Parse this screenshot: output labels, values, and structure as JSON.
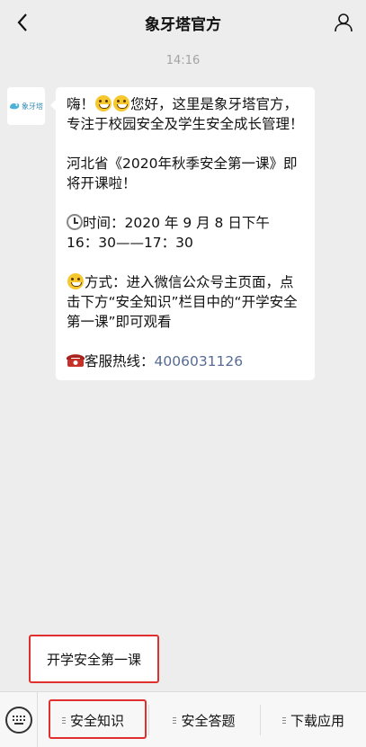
{
  "header": {
    "title": "象牙塔官方"
  },
  "timestamp": "14:16",
  "avatar": {
    "logo_text": "象牙塔"
  },
  "message": {
    "para1": "嗨！😀😀您好，这里是象牙塔官方，专注于校园安全及学生安全成长管理！",
    "para1_prefix": "嗨！",
    "para1_body": "您好，这里是象牙塔官方，专注于校园安全及学生安全成长管理！",
    "para2": "河北省《2020年秋季安全第一课》即将开课啦！",
    "time_label": "时间：",
    "time_value_line1": "2020 年 9 月 8 日下午",
    "time_value_line2": "16：30——17：30",
    "method_label": "方式：",
    "method_value": "进入微信公众号主页面，点击下方“安全知识”栏目中的“开学安全第一课”即可观看",
    "hotline_label": "客服热线：",
    "hotline_number": "4006031126"
  },
  "quick_reply": {
    "label": "开学安全第一课"
  },
  "bottom_menu": {
    "items": [
      {
        "label": "安全知识"
      },
      {
        "label": "安全答题"
      },
      {
        "label": "下载应用"
      }
    ]
  },
  "colors": {
    "link": "#576b95",
    "highlight_border": "#e0302d",
    "background": "#ededed"
  },
  "icons": {
    "back": "chevron-left-icon",
    "profile": "person-icon",
    "keyboard": "keyboard-icon",
    "emoji": "grinning-face-icon",
    "clock": "clock-icon",
    "phone": "telephone-icon"
  }
}
